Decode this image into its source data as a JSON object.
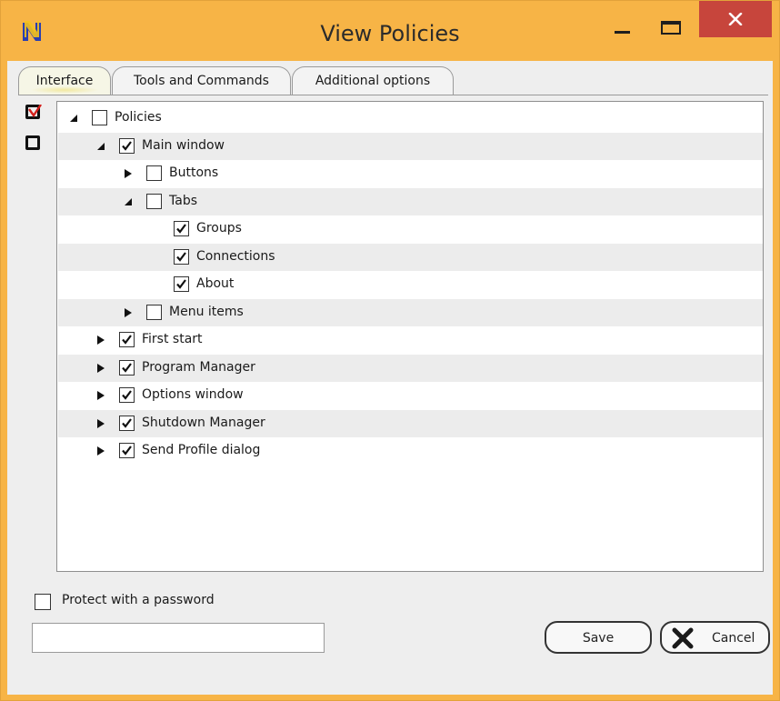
{
  "window": {
    "title": "View Policies"
  },
  "tabs": [
    {
      "label": "Interface",
      "active": true
    },
    {
      "label": "Tools and Commands",
      "active": false
    },
    {
      "label": "Additional options",
      "active": false
    }
  ],
  "side_controls": [
    {
      "name": "check-all",
      "state": "checked-red"
    },
    {
      "name": "uncheck-all",
      "state": "unchecked"
    }
  ],
  "tree": [
    {
      "label": "Policies",
      "expander": "expanded",
      "checked": false
    },
    {
      "label": "Main window",
      "expander": "expanded",
      "checked": true
    },
    {
      "label": "Buttons",
      "expander": "collapsed",
      "checked": false
    },
    {
      "label": "Tabs",
      "expander": "expanded",
      "checked": false
    },
    {
      "label": "Groups",
      "expander": "none",
      "checked": true
    },
    {
      "label": "Connections",
      "expander": "none",
      "checked": true
    },
    {
      "label": "About",
      "expander": "none",
      "checked": true
    },
    {
      "label": "Menu items",
      "expander": "collapsed",
      "checked": false
    },
    {
      "label": "First start",
      "expander": "collapsed",
      "checked": true
    },
    {
      "label": "Program Manager",
      "expander": "collapsed",
      "checked": true
    },
    {
      "label": "Options window",
      "expander": "collapsed",
      "checked": true
    },
    {
      "label": "Shutdown Manager",
      "expander": "collapsed",
      "checked": true
    },
    {
      "label": "Send Profile dialog",
      "expander": "collapsed",
      "checked": true
    }
  ],
  "password": {
    "checkbox_label": "Protect with a password",
    "checked": false,
    "value": ""
  },
  "buttons": {
    "save": "Save",
    "cancel": "Cancel"
  },
  "colors": {
    "title_bar": "#f7b446",
    "close": "#c7453c",
    "alt_row": "#ececec"
  }
}
